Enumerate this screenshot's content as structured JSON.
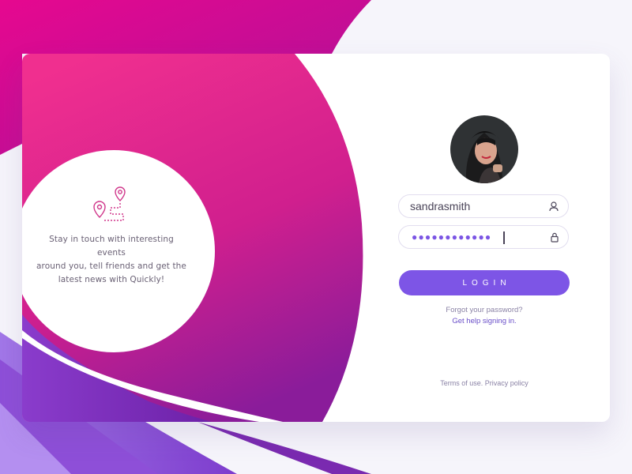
{
  "intro": {
    "icon": "map-route-icon",
    "lines": [
      "Stay in touch with interesting events",
      "around you, tell friends and get the",
      "latest news with Quickly!"
    ]
  },
  "login": {
    "avatar": "user-avatar-photo",
    "username_value": "sandrasmith",
    "username_icon": "user-icon",
    "password_mask": "●●●●●●●●●●●●",
    "password_icon": "lock-icon",
    "button_label": "LOGIN",
    "forgot_text": "Forgot your password?",
    "help_link": "Get help signing in.",
    "terms_link": "Terms of use.",
    "privacy_link": "Privacy policy"
  },
  "colors": {
    "accent": "#7d55e6",
    "brand_pink": "#ec0a8d",
    "brand_purple": "#7b2bb0"
  }
}
